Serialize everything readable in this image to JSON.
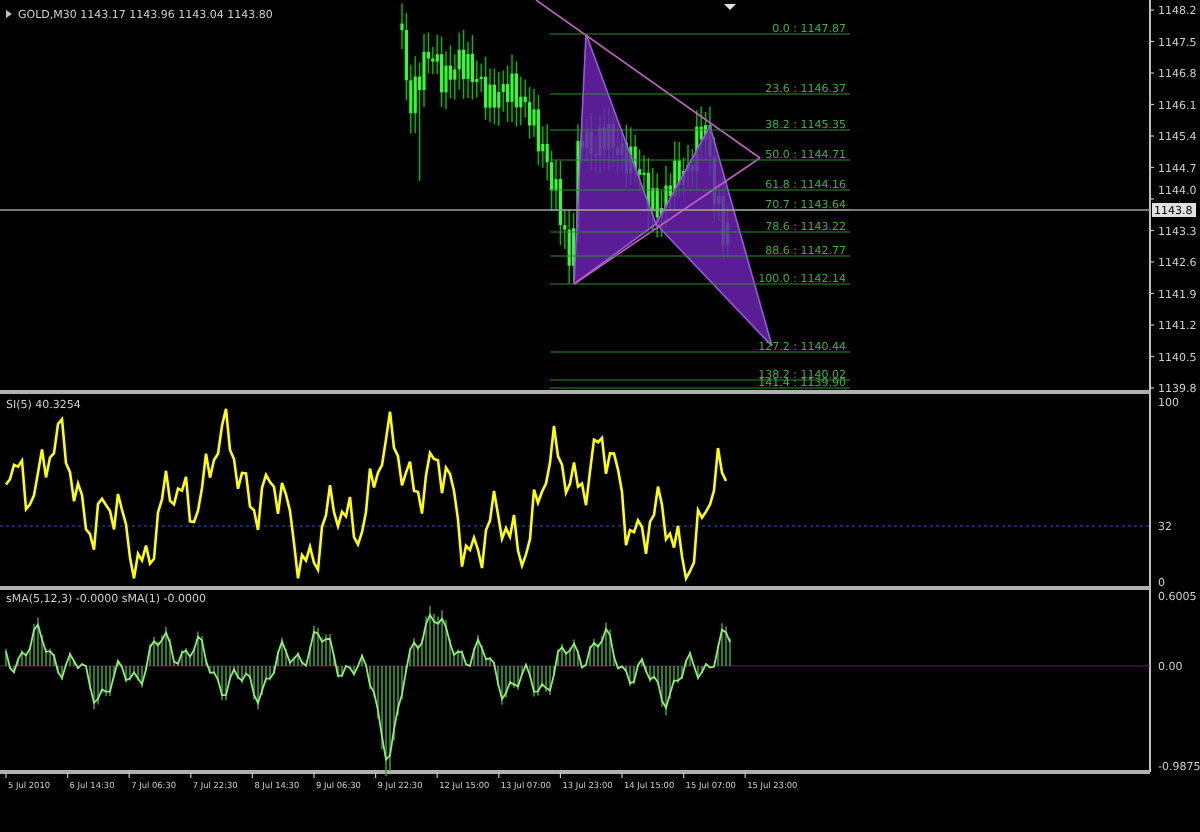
{
  "main_chart": {
    "symbol_info": "GOLD,M30  1143.17 1143.96 1143.04 1143.80",
    "fib_labels": [
      "0.0 : 1147.87",
      "23.6 : 1146.37",
      "38.2 : 1145.35",
      "50.0 : 1144.71",
      "61.8 : 1144.16",
      "70.7 : 1143.64",
      "78.6 : 1143.22",
      "88.6 : 1142.77",
      "100.0 : 1142.14",
      "127.2 : 1140.44",
      "138.2 : 1140.02",
      "141.4 : 1139.90"
    ],
    "price_axis": [
      "1148.2",
      "1147.5",
      "1146.8",
      "1146.1",
      "1145.4",
      "1144.7",
      "1144.0",
      "1143.3",
      "1142.6",
      "1141.9",
      "1141.2",
      "1140.5",
      "1139.8"
    ],
    "current_price": "1143.8"
  },
  "indicator_1": {
    "title": "SI(5) 40.3254",
    "axis": [
      "100",
      "32",
      "0"
    ]
  },
  "indicator_2": {
    "title": "sMA(5,12,3) -0.0000  sMA(1) -0.0000",
    "axis": [
      "0.6005",
      "0.00",
      "-0.9875"
    ]
  },
  "time_axis": [
    "5 Jul 2010",
    "6 Jul 14:30",
    "7 Jul 06:30",
    "7 Jul 22:30",
    "8 Jul 14:30",
    "9 Jul 06:30",
    "9 Jul 22:30",
    "12 Jul 15:00",
    "13 Jul 07:00",
    "13 Jul 23:00",
    "14 Jul 15:00",
    "15 Jul 07:00",
    "15 Jul 23:00"
  ]
}
